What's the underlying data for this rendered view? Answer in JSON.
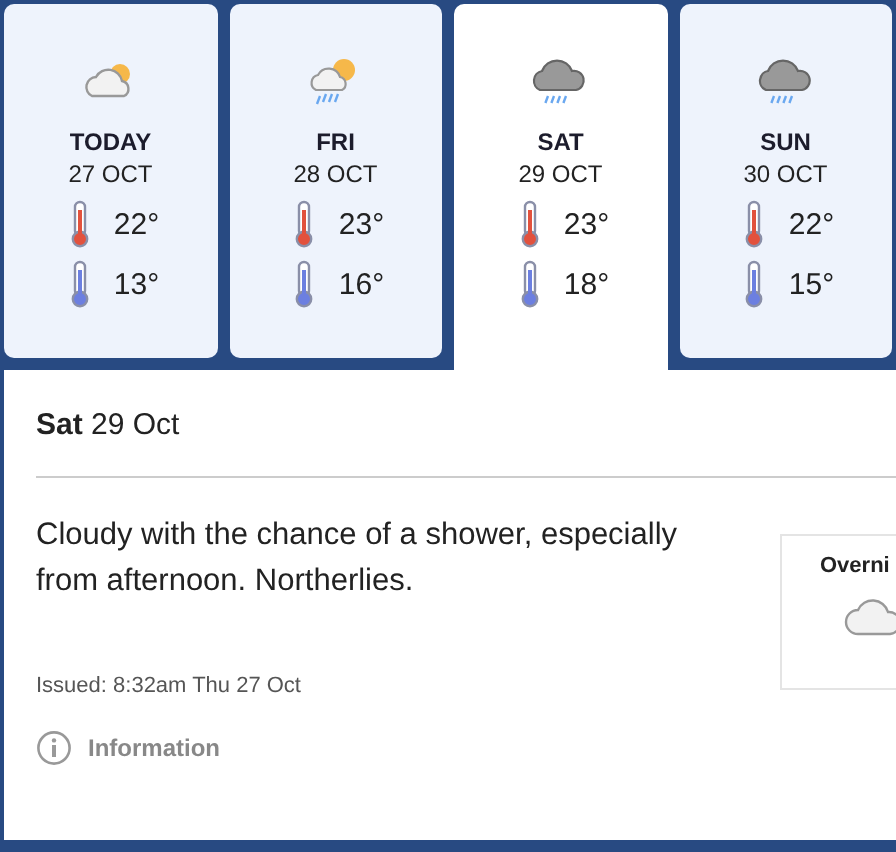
{
  "days": [
    {
      "day": "TODAY",
      "date": "27 OCT",
      "kind": "partly-cloudy",
      "max": "22°",
      "min": "13°",
      "selected": false
    },
    {
      "day": "FRI",
      "date": "28 OCT",
      "kind": "partly-cloudy-showers",
      "max": "23°",
      "min": "16°",
      "selected": false
    },
    {
      "day": "SAT",
      "date": "29 OCT",
      "kind": "showers",
      "max": "23°",
      "min": "18°",
      "selected": true
    },
    {
      "day": "SUN",
      "date": "30 OCT",
      "kind": "showers",
      "max": "22°",
      "min": "15°",
      "selected": false
    }
  ],
  "detail": {
    "heading": "**Sat** 29 Oct",
    "description": "Cloudy with the chance of a shower, especially from afternoon. Northerlies.",
    "issued": "Issued: 8:32am Thu 27 Oct",
    "info_link": "Information",
    "side_panel": {
      "title": "Overni"
    }
  }
}
